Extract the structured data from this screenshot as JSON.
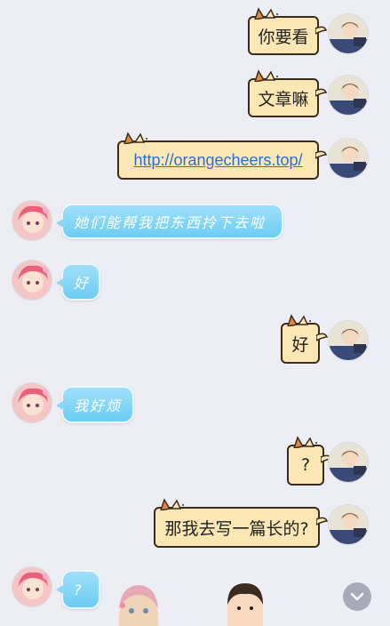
{
  "messages": [
    {
      "sender": "me",
      "text": "你要看"
    },
    {
      "sender": "me",
      "text": "文章嘛"
    },
    {
      "sender": "me",
      "text": "http://orangecheers.top/"
    },
    {
      "sender": "her",
      "text": "她们能帮我把东西拎下去啦"
    },
    {
      "sender": "her",
      "text": "好"
    },
    {
      "sender": "me",
      "text": "好"
    },
    {
      "sender": "her",
      "text": "我好烦"
    },
    {
      "sender": "me",
      "text": "?"
    },
    {
      "sender": "me",
      "text": "那我去写一篇长的?"
    },
    {
      "sender": "her",
      "text": "?"
    }
  ],
  "icons": {
    "scroll_down": "chevron-down-icon"
  },
  "colors": {
    "background": "#eceef4",
    "me_bubble": "#fbe7b4",
    "her_bubble": "#6ccdf2",
    "link": "#2a6fd8"
  }
}
